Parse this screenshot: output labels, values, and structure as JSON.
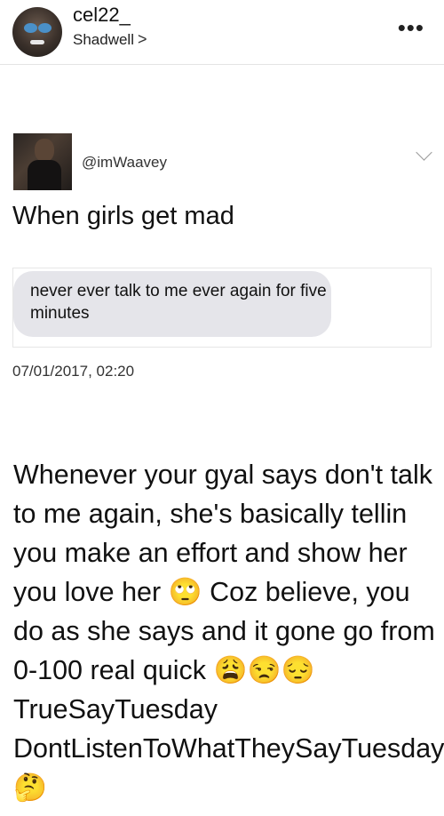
{
  "post": {
    "username": "cel22_",
    "location": "Shadwell",
    "location_chevron": ">",
    "more_glyph": "•••"
  },
  "tweet": {
    "handle": "@imWaavey",
    "text": "When girls get mad",
    "message_text": "never ever talk to me ever again for five minutes",
    "timestamp": "07/01/2017, 02:20"
  },
  "caption": {
    "text": "Whenever your gyal says don't talk to me again, she's basically tellin you make an effort and show her you love her 🙄 Coz believe, you do as she says and it gone go from 0-100 real quick 😩😒😔 TrueSayTuesday DontListenToWhatTheySayTuesday 🤔"
  },
  "icons": {
    "avatar": "profile-avatar-icon",
    "more": "more-options-icon",
    "chevron": "chevron-right-icon",
    "expand": "chevron-down-icon"
  }
}
